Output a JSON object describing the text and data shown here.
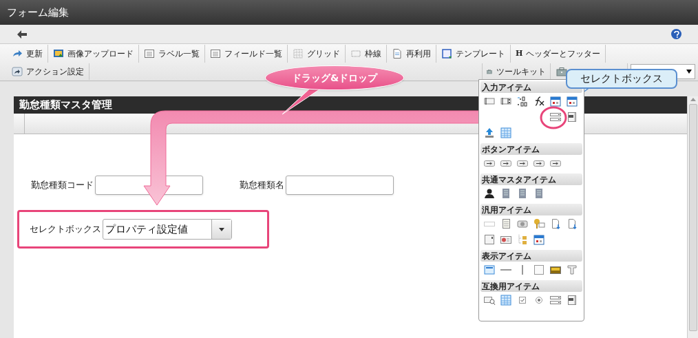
{
  "window": {
    "title": "フォーム編集"
  },
  "toolbar": [
    {
      "label": "更新"
    },
    {
      "label": "画像アップロード"
    },
    {
      "label": "ラベル一覧"
    },
    {
      "label": "フィールド一覧"
    },
    {
      "label": "グリッド"
    },
    {
      "label": "枠線"
    },
    {
      "label": "再利用"
    },
    {
      "label": "テンプレート"
    },
    {
      "label": "ヘッダーとフッター",
      "glyph": "H"
    }
  ],
  "toolbar_row2": [
    {
      "label": "アクション設定"
    }
  ],
  "toolkit_buttons": [
    {
      "label": "ツールキット"
    }
  ],
  "form": {
    "title": "勤怠種類マスタ管理",
    "fields": [
      {
        "label": "勤怠種類コード"
      },
      {
        "label": "勤怠種類名"
      }
    ],
    "select": {
      "label": "セレクトボックス",
      "value": "プロパティ設定値",
      "highlighted": true
    }
  },
  "toolkit": {
    "sections": [
      {
        "title": "入力アイテム"
      },
      {
        "title": "ボタンアイテム"
      },
      {
        "title": "共通マスタアイテム"
      },
      {
        "title": "汎用アイテム"
      },
      {
        "title": "表示アイテム"
      },
      {
        "title": "互換用アイテム"
      }
    ]
  },
  "callouts": [
    {
      "text": "ドラッグ&ドロップ"
    },
    {
      "text": "セレクトボックス"
    }
  ]
}
